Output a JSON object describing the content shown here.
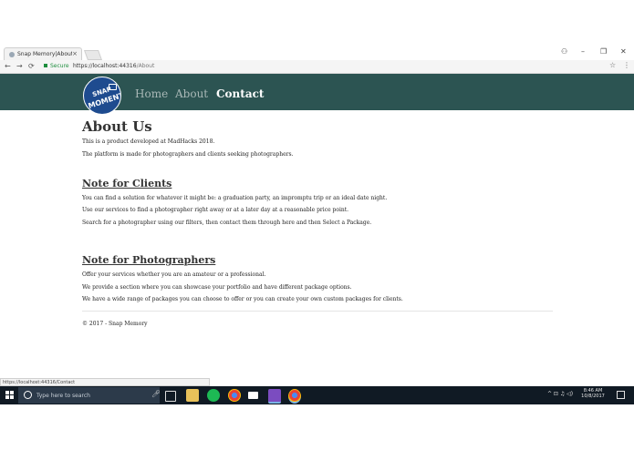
{
  "browser": {
    "tab_title": "Snap Memory|About Us",
    "tab_close": "×",
    "window_controls": {
      "account": "⚇",
      "minimize": "–",
      "restore": "❐",
      "close": "✕"
    },
    "secure_label": "Secure",
    "url_scheme_host": "https://localhost:44316",
    "url_path": "/About",
    "status_url": "https://localhost:44316/Contact"
  },
  "navbar": {
    "logo_text_1": "SNAP",
    "logo_text_2": "MOMENT",
    "links": [
      {
        "label": "Home",
        "active": false
      },
      {
        "label": "About",
        "active": false
      },
      {
        "label": "Contact",
        "active": true
      }
    ]
  },
  "page": {
    "title": "About Us",
    "intro": [
      "This is a product developed at MadHacks 2018.",
      "The platform is made for photographers and clients seeking photographers."
    ],
    "clients": {
      "heading": "Note for Clients",
      "lines": [
        "You can find a solution for whatever it might be: a graduation party, an impromptu trip or an ideal date night.",
        "Use our services to find a photographer right away or at a later day at a reasonable price point.",
        "Search for a photographer using our filters, then contact them through here and then Select a Package."
      ]
    },
    "photographers": {
      "heading": "Note for Photographers",
      "lines": [
        "Offer your services whether you are an amateur or a professional.",
        "We provide a section where you can showcase your portfolio and have different package options.",
        "We have a wide range of packages you can choose to offer or you can create your own custom packages for clients."
      ]
    },
    "footer": "© 2017 - Snap Memory"
  },
  "taskbar": {
    "search_placeholder": "Type here to search",
    "tray_text": "^ ⊡ ♫ ◁)",
    "time": "8:46 AM",
    "date": "10/8/2017"
  },
  "colors": {
    "navbar_bg": "#2c5452",
    "logo_bg": "#1e4b8f",
    "taskbar_bg": "#101a24"
  }
}
